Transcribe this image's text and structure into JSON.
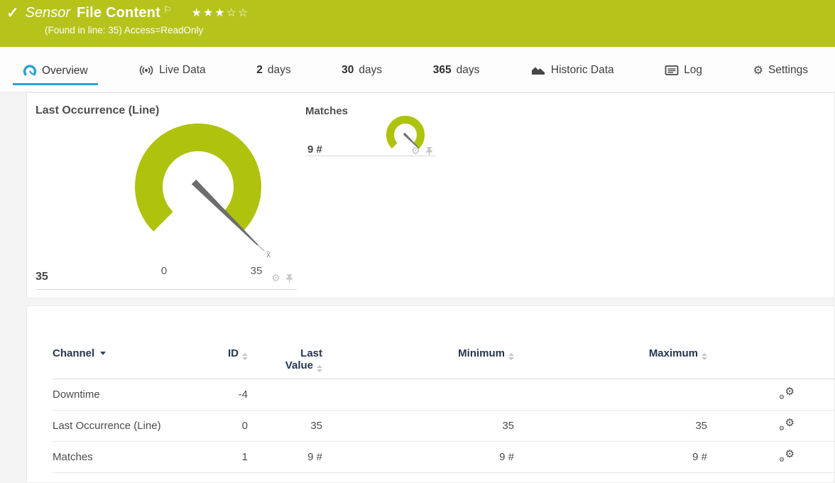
{
  "colors": {
    "brand_green": "#b5c31b",
    "gauge_green": "#afc20e",
    "accent_blue": "#2aa2da"
  },
  "header": {
    "check_icon": "✓",
    "kind_label": "Sensor",
    "title": "File Content",
    "flag_icon": "⚐",
    "rating": {
      "filled": 3,
      "total": 5,
      "stars_text": "★★★☆☆"
    },
    "subtitle": "(Found in line: 35) Access=ReadOnly"
  },
  "tabs": [
    {
      "label": "Overview",
      "icon": "gauge-icon",
      "active": true
    },
    {
      "label": "Live Data",
      "icon": "broadcast-icon",
      "active": false
    },
    {
      "prefix": "2",
      "label": "days",
      "active": false
    },
    {
      "prefix": "30",
      "label": "days",
      "active": false
    },
    {
      "prefix": "365",
      "label": "days",
      "active": false
    },
    {
      "label": "Historic Data",
      "icon": "area-chart-icon",
      "active": false
    },
    {
      "label": "Log",
      "icon": "log-icon",
      "active": false
    },
    {
      "label": "Settings",
      "icon": "gear-icon",
      "active": false
    }
  ],
  "gauges": {
    "primary": {
      "title": "Last Occurrence (Line)",
      "value_label": "35",
      "value": 35,
      "scale_min": "0",
      "scale_max": "35",
      "min": 0,
      "max": 35,
      "avg_marker": "x̄"
    },
    "secondary": {
      "title": "Matches",
      "value_label": "9 #",
      "value": 9
    }
  },
  "icons": {
    "gear": "⚙"
  },
  "table": {
    "headers": {
      "channel": "Channel",
      "id": "ID",
      "last_value_line1": "Last",
      "last_value_line2": "Value",
      "minimum": "Minimum",
      "maximum": "Maximum"
    },
    "rows": [
      {
        "channel": "Downtime",
        "id": "-4",
        "last": "",
        "min": "",
        "max": ""
      },
      {
        "channel": "Last Occurrence (Line)",
        "id": "0",
        "last": "35",
        "min": "35",
        "max": "35"
      },
      {
        "channel": "Matches",
        "id": "1",
        "last": "9 #",
        "min": "9 #",
        "max": "9 #"
      }
    ]
  }
}
